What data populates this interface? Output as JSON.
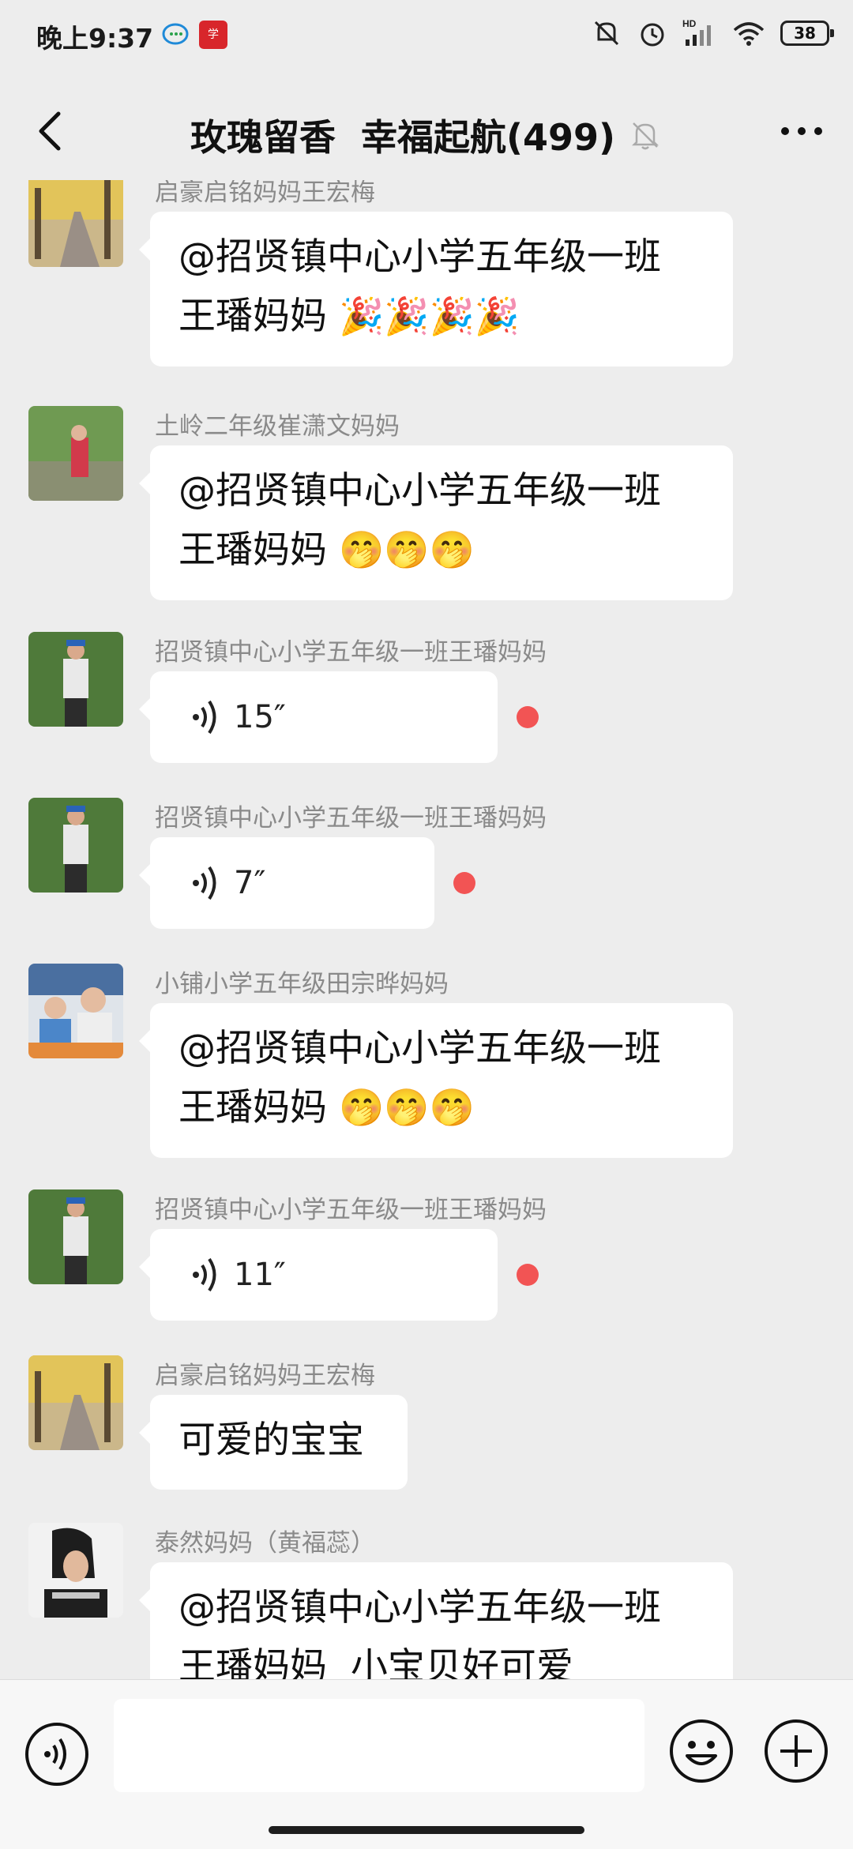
{
  "status_bar": {
    "time": "晚上9:37",
    "battery": "38",
    "icons": [
      "chat-app-icon",
      "study-app-icon",
      "mute-icon",
      "alarm-icon",
      "hd-signal-icon",
      "wifi-icon",
      "battery-icon"
    ]
  },
  "header": {
    "title": "玫瑰留香  幸福起航(499)",
    "back_icon": "chevron-left-icon",
    "mute_icon": "bell-off-icon",
    "more_icon": "more-dots-icon"
  },
  "messages": [
    {
      "type": "text",
      "sender": "启豪启铭妈妈王宏梅",
      "line1": "@招贤镇中心小学五年级一班",
      "line2": "王璠妈妈",
      "emoji": "🎉🎉🎉🎉"
    },
    {
      "type": "text",
      "sender": "土岭二年级崔潇文妈妈",
      "line1": "@招贤镇中心小学五年级一班",
      "line2": "王璠妈妈",
      "emoji": "🤭🤭🤭"
    },
    {
      "type": "voice",
      "sender": "招贤镇中心小学五年级一班王璠妈妈",
      "duration": "15″",
      "unread": true
    },
    {
      "type": "voice",
      "sender": "招贤镇中心小学五年级一班王璠妈妈",
      "duration": "7″",
      "unread": true
    },
    {
      "type": "text",
      "sender": "小铺小学五年级田宗晔妈妈",
      "line1": "@招贤镇中心小学五年级一班",
      "line2": "王璠妈妈",
      "emoji": "🤭🤭🤭"
    },
    {
      "type": "voice",
      "sender": "招贤镇中心小学五年级一班王璠妈妈",
      "duration": "11″",
      "unread": true
    },
    {
      "type": "text",
      "sender": "启豪启铭妈妈王宏梅",
      "line1": "可爱的宝宝"
    },
    {
      "type": "text",
      "sender": "泰然妈妈（黄福蕊）",
      "line1": "@招贤镇中心小学五年级一班",
      "line2": "王璠妈妈  小宝贝好可爱"
    }
  ],
  "input_bar": {
    "voice_icon": "voice-input-icon",
    "emoji_icon": "emoji-icon",
    "plus_icon": "plus-icon"
  },
  "colors": {
    "background": "#ededed",
    "bubble": "#ffffff",
    "unread_dot": "#f25454",
    "sender_text": "#8a8a8a"
  }
}
